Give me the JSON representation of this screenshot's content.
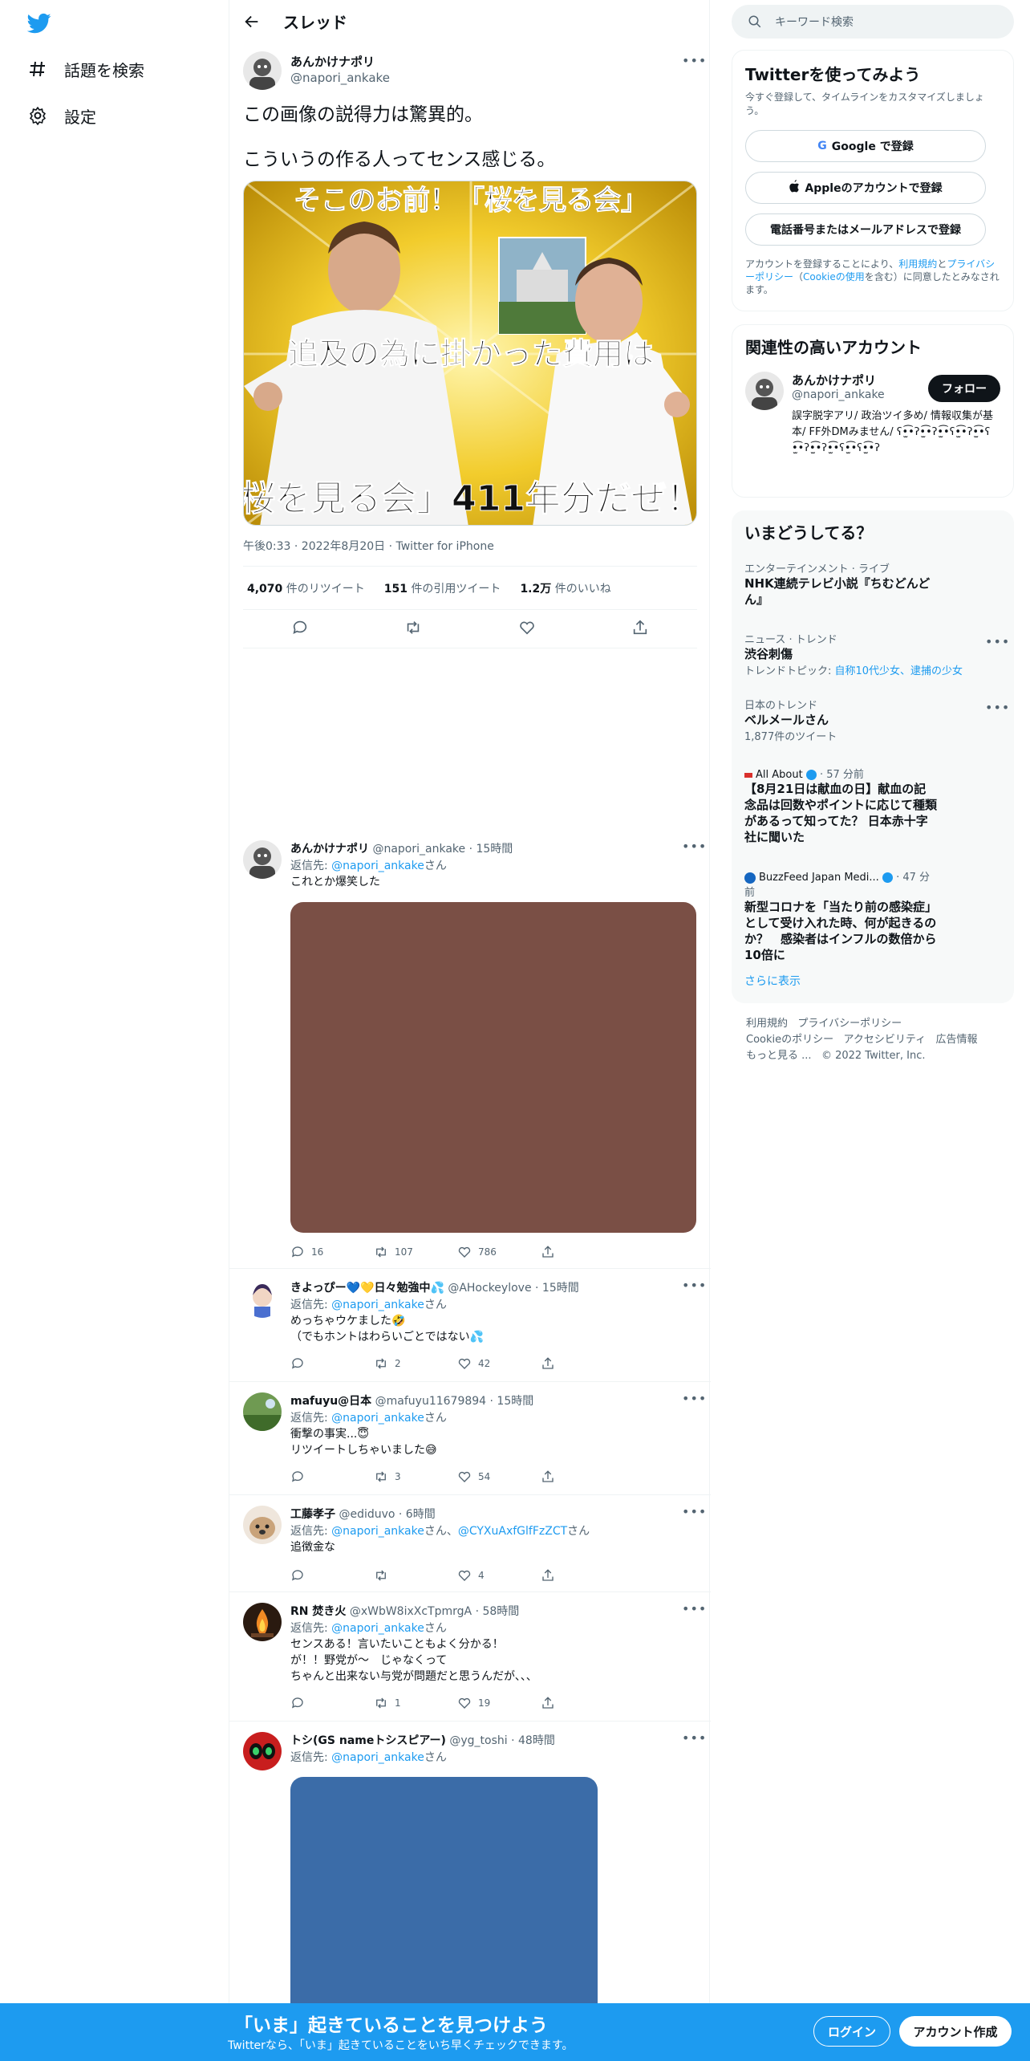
{
  "nav": {
    "explore_label": "話題を検索",
    "settings_label": "設定"
  },
  "header": {
    "title": "スレッド"
  },
  "main_tweet": {
    "name": "あんかけナポリ",
    "handle": "@napori_ankake",
    "text_line1": "この画像の説得力は驚異的。",
    "text_line2": "こういうの作る人ってセンス感じる。",
    "image_text_top": "そこのお前！「桜を見る会」",
    "image_text_mid": "追及の為に掛かった費用は",
    "image_text_bottom": "「桜を見る会」411年分だぜ！！",
    "timestamp": "午後0:33 · 2022年8月20日 · Twitter for iPhone",
    "retweets_num": "4,070",
    "retweets_label": "件のリツイート",
    "quotes_num": "151",
    "quotes_label": "件の引用ツイート",
    "likes_num": "1.2万",
    "likes_label": "件のいいね"
  },
  "replies": [
    {
      "name": "あんかけナポリ",
      "handle": "@napori_ankake",
      "time": "· 15時間",
      "reply_prefix": "返信先: ",
      "reply_to": "@napori_ankake",
      "reply_suffix": "さん",
      "text": "これとか爆笑した",
      "replies": "16",
      "retweets": "107",
      "likes": "786"
    },
    {
      "name": "きよっぴー💙💛日々勉強中💦",
      "handle": "@AHockeylove",
      "time": "· 15時間",
      "reply_prefix": "返信先: ",
      "reply_to": "@napori_ankake",
      "reply_suffix": "さん",
      "text1": "めっちゃウケました🤣",
      "text2": "（でもホントはわらいごとではない💦",
      "replies": "",
      "retweets": "2",
      "likes": "42"
    },
    {
      "name": "mafuyu@日本",
      "handle": "@mafuyu11679894",
      "time": "· 15時間",
      "reply_prefix": "返信先: ",
      "reply_to": "@napori_ankake",
      "reply_suffix": "さん",
      "text1": "衝撃の事実...😇",
      "text2": "リツイートしちゃいました😅",
      "replies": "",
      "retweets": "3",
      "likes": "54"
    },
    {
      "name": "工藤孝子",
      "handle": "@ediduvo",
      "time": "· 6時間",
      "reply_prefix": "返信先: ",
      "reply_to": "@napori_ankake",
      "reply_mid": "さん、",
      "reply_to2": "@CYXuAxfGlfFzZCT",
      "reply_suffix": "さん",
      "text": "追徴金な",
      "replies": "",
      "retweets": "",
      "likes": "4"
    },
    {
      "name": "RN 焚き火",
      "handle": "@xWbW8ixXcTpmrgA",
      "time": "· 58時間",
      "reply_prefix": "返信先: ",
      "reply_to": "@napori_ankake",
      "reply_suffix": "さん",
      "text1": "センスある！言いたいこともよく分かる！",
      "text2": "が！！野党が〜　じゃなくって",
      "text3": "ちゃんと出来ない与党が問題だと思うんだが、、、",
      "replies": "",
      "retweets": "1",
      "likes": "19"
    },
    {
      "name": "トシ(GS nameトシスピアー)",
      "handle": "@yg_toshi",
      "time": "· 48時間",
      "reply_prefix": "返信先: ",
      "reply_to": "@napori_ankake",
      "reply_suffix": "さん"
    }
  ],
  "right": {
    "search_placeholder": "キーワード検索",
    "signup_card": {
      "title": "Twitterを使ってみよう",
      "subtitle": "今すぐ登録して、タイムラインをカスタマイズしましょう。",
      "google_btn": "Google で登録",
      "apple_btn": "Appleのアカウントで登録",
      "phone_btn": "電話番号またはメールアドレスで登録",
      "terms_1": "アカウントを登録することにより、",
      "terms_link1": "利用規約",
      "terms_2": "と",
      "terms_link2": "プライバシーポリシー",
      "terms_3": "（",
      "terms_link3": "Cookieの使用",
      "terms_4": "を含む）に同意したとみなされます。"
    },
    "related": {
      "title": "関連性の高いアカウント",
      "name": "あんかけナポリ",
      "handle": "@napori_ankake",
      "follow_btn": "フォロー",
      "bio": "誤字脱字アリ/ 政治ツイ多め/ 情報収集が基本/ FF外DMみません/ ʕ•̫͡•ʔ•̫͡•ʔ•̫͡•ʕ•̫͡•ʔ•̫͡•ʕ•̫͡•ʔ•̫͡•ʔ•̫͡•ʕ•̫͡•ʕ•̫͡•ʔ"
    },
    "trends": {
      "title": "いまどうしてる？",
      "items": [
        {
          "cat": "エンターテインメント · ライブ",
          "ttl": "NHK連続テレビ小説『ちむどんどん』"
        },
        {
          "cat": "ニュース · トレンド",
          "ttl": "渋谷刺傷",
          "sub_label": "トレンドトピック: ",
          "sub_link": "自称10代少女、逮捕の少女"
        },
        {
          "cat": "日本のトレンド",
          "ttl": "ベルメールさん",
          "sub": "1,877件のツイート"
        },
        {
          "source": "All About",
          "time": "· 57 分前",
          "ttl": "【8月21日は献血の日】献血の記念品は回数やポイントに応じて種類があるって知ってた？ 日本赤十字社に聞いた"
        },
        {
          "source": "BuzzFeed Japan Medi...",
          "time": "· 47 分前",
          "ttl": "新型コロナを「当たり前の感染症」として受け入れた時、何が起きるのか？　感染者はインフルの数倍から10倍に"
        }
      ],
      "show_more": "さらに表示"
    },
    "footer": {
      "l1a": "利用規約",
      "l1b": "プライバシーポリシー",
      "l2a": "Cookieのポリシー",
      "l2b": "アクセシビリティ",
      "l2c": "広告情報",
      "l3a": "もっと見る ...",
      "l3b": "© 2022 Twitter, Inc."
    }
  },
  "bottom_bar": {
    "title": "「いま」起きていることを見つけよう",
    "subtitle": "Twitterなら、「いま」起きていることをいち早くチェックできます。",
    "login": "ログイン",
    "signup": "アカウント作成"
  },
  "colors": {
    "accent": "#1d9bf0",
    "text": "#0f1419",
    "muted": "#536471"
  }
}
